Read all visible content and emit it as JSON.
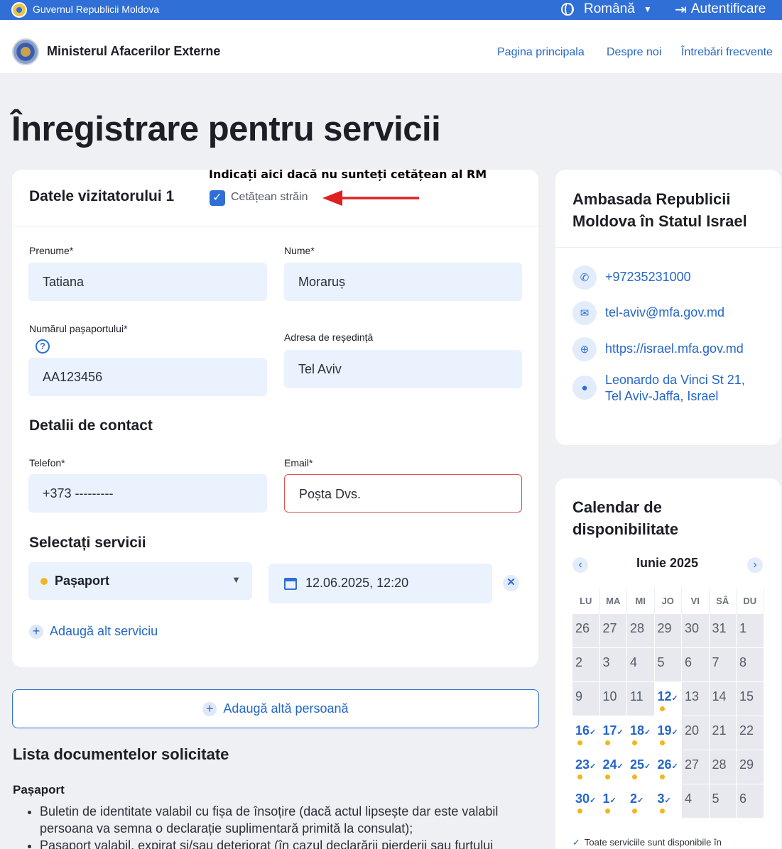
{
  "gov_bar": {
    "title": "Guvernul Republicii Moldova",
    "language": "Română",
    "login": "Autentificare"
  },
  "header": {
    "ministry": "Ministerul Afacerilor Externe",
    "nav": [
      "Pagina principala",
      "Despre noi",
      "Întrebări frecvente"
    ]
  },
  "page_title": "Înregistrare pentru servicii",
  "annotation": "Indicați aici dacă nu sunteți cetățean al RM",
  "visitor": {
    "title": "Datele vizitatorului 1",
    "foreign_label": "Cetățean străin",
    "foreign_checked": "✓",
    "first_name_label": "Prenume*",
    "first_name_value": "Tatiana",
    "last_name_label": "Nume*",
    "last_name_value": "Moraruș",
    "passport_label": "Numărul pașaportului*",
    "passport_value": "AA123456",
    "address_label": "Adresa de reședință",
    "address_value": "Tel Aviv",
    "contact_section": "Detalii de contact",
    "phone_label": "Telefon*",
    "phone_value": "+373 ---------",
    "email_label": "Email*",
    "email_placeholder": "Poșta Dvs.",
    "service_section": "Selectați servicii",
    "service_value": "Pașaport",
    "datetime_value": "12.06.2025, 12:20",
    "add_service": "Adaugă alt serviciu"
  },
  "add_person": "Adaugă altă persoană",
  "documents": {
    "title": "Lista documentelor solicitate",
    "subtitle": "Pașaport",
    "items": [
      "Buletin de identitate valabil cu fișa de însoțire (dacă actul lipsește dar este valabil persoana va semna o declarație suplimentară primită la consulat);",
      "Pașaport valabil, expirat și/sau deteriorat (în cazul declarării pierderii sau furtului"
    ]
  },
  "embassy": {
    "title": "Ambasada Republicii Moldova în Statul Israel",
    "phone": "+97235231000",
    "email": "tel-aviv@mfa.gov.md",
    "website": "https://israel.mfa.gov.md",
    "address": "Leonardo da Vinci St 21, Tel Aviv-Jaffa, Israel"
  },
  "calendar": {
    "title": "Calendar de disponibilitate",
    "month": "Iunie 2025",
    "weekdays": [
      "LU",
      "MA",
      "MI",
      "JO",
      "VI",
      "SÂ",
      "DU"
    ],
    "days": [
      {
        "d": "26",
        "a": false
      },
      {
        "d": "27",
        "a": false
      },
      {
        "d": "28",
        "a": false
      },
      {
        "d": "29",
        "a": false
      },
      {
        "d": "30",
        "a": false
      },
      {
        "d": "31",
        "a": false
      },
      {
        "d": "1",
        "a": false
      },
      {
        "d": "2",
        "a": false
      },
      {
        "d": "3",
        "a": false
      },
      {
        "d": "4",
        "a": false
      },
      {
        "d": "5",
        "a": false
      },
      {
        "d": "6",
        "a": false
      },
      {
        "d": "7",
        "a": false
      },
      {
        "d": "8",
        "a": false
      },
      {
        "d": "9",
        "a": false
      },
      {
        "d": "10",
        "a": false
      },
      {
        "d": "11",
        "a": false
      },
      {
        "d": "12",
        "a": true
      },
      {
        "d": "13",
        "a": false
      },
      {
        "d": "14",
        "a": false
      },
      {
        "d": "15",
        "a": false
      },
      {
        "d": "16",
        "a": true
      },
      {
        "d": "17",
        "a": true
      },
      {
        "d": "18",
        "a": true
      },
      {
        "d": "19",
        "a": true
      },
      {
        "d": "20",
        "a": false
      },
      {
        "d": "21",
        "a": false
      },
      {
        "d": "22",
        "a": false
      },
      {
        "d": "23",
        "a": true
      },
      {
        "d": "24",
        "a": true
      },
      {
        "d": "25",
        "a": true
      },
      {
        "d": "26",
        "a": true
      },
      {
        "d": "27",
        "a": false
      },
      {
        "d": "28",
        "a": false
      },
      {
        "d": "29",
        "a": false
      },
      {
        "d": "30",
        "a": true
      },
      {
        "d": "1",
        "a": true
      },
      {
        "d": "2",
        "a": true
      },
      {
        "d": "3",
        "a": true
      },
      {
        "d": "4",
        "a": false
      },
      {
        "d": "5",
        "a": false
      },
      {
        "d": "6",
        "a": false
      }
    ],
    "note": "Toate serviciile sunt disponibile în"
  },
  "colors": {
    "primary": "#2f6fd6",
    "link": "#2466c9",
    "available_dot": "#f2b51c",
    "error_border": "#d9534f"
  }
}
